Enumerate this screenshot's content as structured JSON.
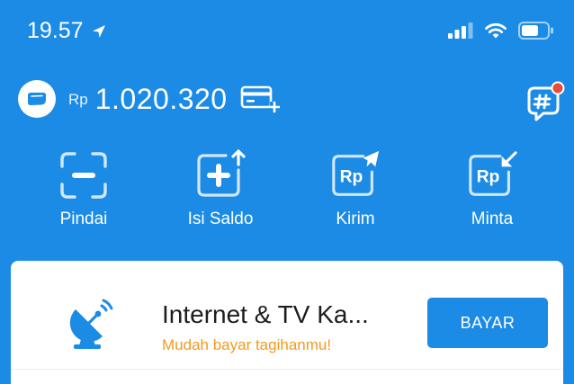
{
  "status_bar": {
    "time": "19.57"
  },
  "wallet": {
    "currency": "Rp",
    "balance": "1.020.320"
  },
  "actions": [
    {
      "label": "Pindai",
      "icon": "scan-icon"
    },
    {
      "label": "Isi Saldo",
      "icon": "top-up-icon"
    },
    {
      "label": "Kirim",
      "icon": "send-money-icon"
    },
    {
      "label": "Minta",
      "icon": "request-money-icon"
    }
  ],
  "action_icon_text": "Rp",
  "promo": {
    "title": "Internet & TV Ka...",
    "subtitle": "Mudah bayar tagihanmu!",
    "button_label": "BAYAR",
    "icon": "satellite-dish-icon"
  },
  "colors": {
    "brand_blue": "#1B8BE6",
    "accent_orange": "#F39A1E",
    "notification_red": "#E94B3C"
  }
}
